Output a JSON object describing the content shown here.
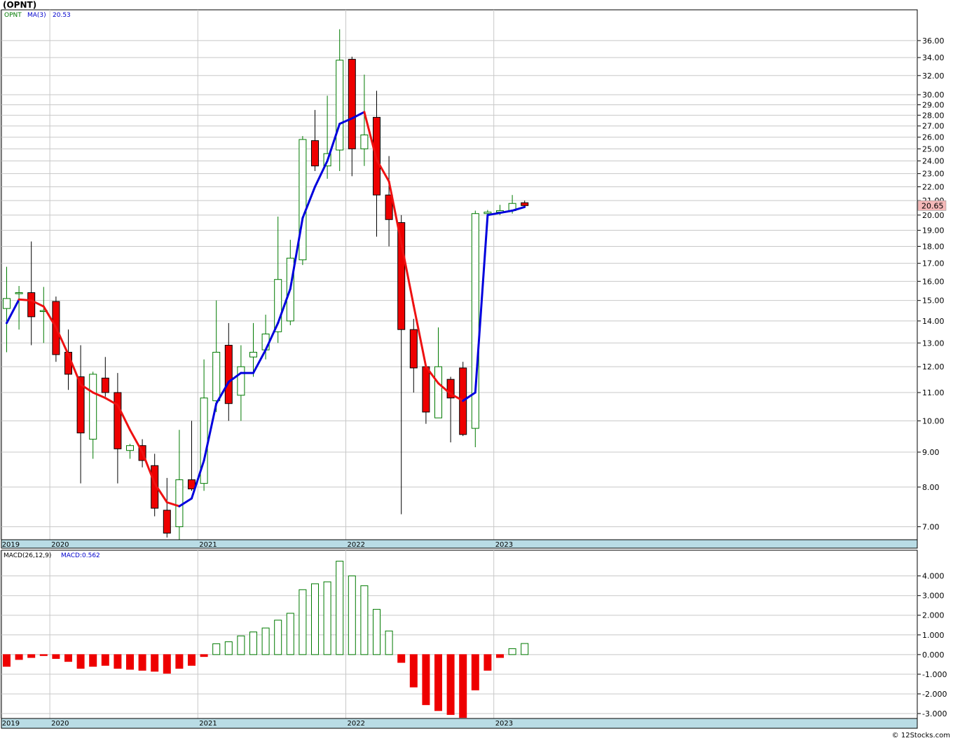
{
  "title": "(OPNT)",
  "watermark": "© 12Stocks.com",
  "colors": {
    "up": "#007a00",
    "down_fill": "#ee0000",
    "ma_up": "#0000dd",
    "ma_down": "#ee1111",
    "grid": "#c8c8c8",
    "axis_band": "#b9dce5",
    "price_tag_bg": "#f4b8b8"
  },
  "chart_data": [
    {
      "type": "candlestick",
      "title": "(OPNT)",
      "legend": {
        "symbol": "OPNT",
        "ma_label": "MA(3)",
        "ma_value": "20.53"
      },
      "scale": "log",
      "ylim": [
        6.7,
        39.0
      ],
      "y_ticks": [
        7,
        8,
        9,
        10,
        11,
        12,
        13,
        14,
        15,
        16,
        17,
        18,
        19,
        20,
        21,
        22,
        23,
        24,
        25,
        26,
        27,
        28,
        29,
        30,
        32,
        34,
        36
      ],
      "y_tick_labels": [
        "7.00",
        "8.00",
        "9.00",
        "10.00",
        "11.00",
        "12.00",
        "13.00",
        "14.00",
        "15.00",
        "16.00",
        "17.00",
        "18.00",
        "19.00",
        "20.00",
        "21.00",
        "22.00",
        "23.00",
        "24.00",
        "25.00",
        "26.00",
        "27.00",
        "28.00",
        "29.00",
        "30.00",
        "32.00",
        "34.00",
        "36.00"
      ],
      "last_price": "20.65",
      "x_labels": [
        {
          "label": "2019",
          "index": -0.5
        },
        {
          "label": "2020",
          "index": 3.5
        },
        {
          "label": "2021",
          "index": 15.5
        },
        {
          "label": "2022",
          "index": 27.5
        },
        {
          "label": "2023",
          "index": 39.5
        }
      ],
      "candles": [
        {
          "o": 14.6,
          "h": 16.8,
          "l": 12.6,
          "c": 15.1
        },
        {
          "o": 15.35,
          "h": 15.75,
          "l": 13.6,
          "c": 15.4
        },
        {
          "o": 15.4,
          "h": 18.3,
          "l": 12.9,
          "c": 14.2
        },
        {
          "o": 14.5,
          "h": 15.7,
          "l": 13.0,
          "c": 14.5
        },
        {
          "o": 14.95,
          "h": 15.2,
          "l": 12.2,
          "c": 12.5
        },
        {
          "o": 12.6,
          "h": 13.6,
          "l": 11.1,
          "c": 11.7
        },
        {
          "o": 11.6,
          "h": 12.9,
          "l": 8.1,
          "c": 9.6
        },
        {
          "o": 9.4,
          "h": 11.8,
          "l": 8.8,
          "c": 11.7
        },
        {
          "o": 11.55,
          "h": 12.4,
          "l": 10.85,
          "c": 11.0
        },
        {
          "o": 11.0,
          "h": 11.75,
          "l": 8.1,
          "c": 9.1
        },
        {
          "o": 9.05,
          "h": 9.25,
          "l": 8.8,
          "c": 9.2
        },
        {
          "o": 9.2,
          "h": 9.4,
          "l": 8.55,
          "c": 8.75
        },
        {
          "o": 8.6,
          "h": 8.95,
          "l": 7.25,
          "c": 7.45
        },
        {
          "o": 7.4,
          "h": 8.25,
          "l": 6.75,
          "c": 6.85
        },
        {
          "o": 7.0,
          "h": 9.7,
          "l": 6.7,
          "c": 8.2
        },
        {
          "o": 8.2,
          "h": 10.0,
          "l": 7.9,
          "c": 7.95
        },
        {
          "o": 8.1,
          "h": 12.3,
          "l": 7.9,
          "c": 10.8
        },
        {
          "o": 10.7,
          "h": 15.0,
          "l": 10.3,
          "c": 12.6
        },
        {
          "o": 12.9,
          "h": 13.9,
          "l": 10.0,
          "c": 10.6
        },
        {
          "o": 10.9,
          "h": 12.9,
          "l": 10.0,
          "c": 12.0
        },
        {
          "o": 12.4,
          "h": 13.9,
          "l": 11.6,
          "c": 12.6
        },
        {
          "o": 12.7,
          "h": 14.3,
          "l": 12.3,
          "c": 13.4
        },
        {
          "o": 13.5,
          "h": 19.9,
          "l": 13.0,
          "c": 16.1
        },
        {
          "o": 14.0,
          "h": 18.4,
          "l": 13.8,
          "c": 17.3
        },
        {
          "o": 17.2,
          "h": 26.1,
          "l": 16.9,
          "c": 25.8
        },
        {
          "o": 25.7,
          "h": 28.5,
          "l": 23.2,
          "c": 23.6
        },
        {
          "o": 23.6,
          "h": 29.9,
          "l": 22.6,
          "c": 24.6
        },
        {
          "o": 24.9,
          "h": 37.4,
          "l": 23.2,
          "c": 33.7
        },
        {
          "o": 33.8,
          "h": 34.1,
          "l": 22.8,
          "c": 25.0
        },
        {
          "o": 25.0,
          "h": 32.1,
          "l": 23.6,
          "c": 26.2
        },
        {
          "o": 27.8,
          "h": 30.4,
          "l": 18.6,
          "c": 21.4
        },
        {
          "o": 21.4,
          "h": 24.4,
          "l": 18.0,
          "c": 19.7
        },
        {
          "o": 19.5,
          "h": 20.0,
          "l": 7.3,
          "c": 13.6
        },
        {
          "o": 13.6,
          "h": 14.1,
          "l": 11.0,
          "c": 11.95
        },
        {
          "o": 12.0,
          "h": 12.0,
          "l": 9.9,
          "c": 10.3
        },
        {
          "o": 10.1,
          "h": 13.7,
          "l": 10.1,
          "c": 12.0
        },
        {
          "o": 11.5,
          "h": 11.6,
          "l": 9.3,
          "c": 10.8
        },
        {
          "o": 11.95,
          "h": 12.2,
          "l": 9.5,
          "c": 9.55
        },
        {
          "o": 9.75,
          "h": 20.3,
          "l": 9.15,
          "c": 20.1
        },
        {
          "o": 20.1,
          "h": 20.35,
          "l": 20.05,
          "c": 20.2
        },
        {
          "o": 20.2,
          "h": 20.7,
          "l": 20.0,
          "c": 20.3
        },
        {
          "o": 20.3,
          "h": 21.4,
          "l": 20.1,
          "c": 20.8
        },
        {
          "o": 20.85,
          "h": 21.0,
          "l": 20.6,
          "c": 20.65
        }
      ],
      "ma": [
        13.9,
        15.05,
        15.0,
        14.7,
        13.7,
        12.5,
        11.3,
        11.0,
        10.8,
        10.55,
        9.7,
        9.0,
        8.1,
        7.6,
        7.5,
        7.7,
        8.75,
        10.6,
        11.4,
        11.75,
        11.75,
        12.7,
        13.9,
        15.6,
        19.8,
        22.0,
        24.0,
        27.2,
        27.7,
        28.3,
        24.1,
        22.4,
        18.2,
        14.75,
        12.0,
        11.35,
        10.95,
        10.7,
        11.0,
        20.0,
        20.15,
        20.3,
        20.55
      ]
    },
    {
      "type": "bar",
      "title": "",
      "legend": {
        "indicator": "MACD(26,12,9)",
        "value_label": "MACD:0.562"
      },
      "ylim": [
        -3.25,
        4.95
      ],
      "y_ticks": [
        -3,
        -2,
        -1,
        0,
        1,
        2,
        3,
        4
      ],
      "y_tick_labels": [
        "-3.000",
        "-2.000",
        "-1.000",
        "0.000",
        "1.000",
        "2.000",
        "3.000",
        "4.000"
      ],
      "x_labels": [
        {
          "label": "2019",
          "index": -0.5
        },
        {
          "label": "2020",
          "index": 3.5
        },
        {
          "label": "2021",
          "index": 15.5
        },
        {
          "label": "2022",
          "index": 27.5
        },
        {
          "label": "2023",
          "index": 39.5
        }
      ],
      "values": [
        -0.6,
        -0.25,
        -0.15,
        -0.05,
        -0.2,
        -0.35,
        -0.7,
        -0.6,
        -0.55,
        -0.7,
        -0.75,
        -0.8,
        -0.85,
        -0.95,
        -0.7,
        -0.55,
        -0.1,
        0.55,
        0.65,
        0.95,
        1.15,
        1.35,
        1.75,
        2.1,
        3.3,
        3.6,
        3.7,
        4.75,
        4.0,
        3.5,
        2.3,
        1.2,
        -0.4,
        -1.65,
        -2.55,
        -2.85,
        -3.05,
        -3.2,
        -1.8,
        -0.8,
        -0.15,
        0.3,
        0.562
      ]
    }
  ]
}
